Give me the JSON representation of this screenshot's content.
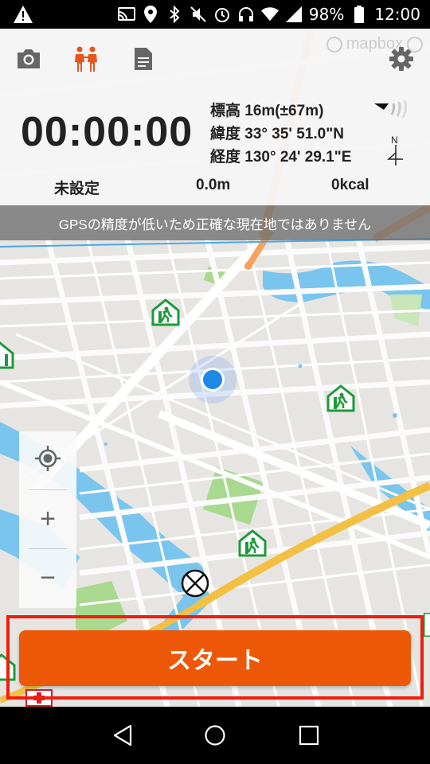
{
  "status_bar": {
    "battery": "98%",
    "time": "12:00",
    "icons": [
      "warning-icon",
      "cast-icon",
      "location-icon",
      "bluetooth-icon",
      "vibrate-icon",
      "alarm-icon",
      "headset-icon",
      "wifi-icon",
      "signal-icon",
      "battery-icon"
    ]
  },
  "toolbar": {
    "icons": [
      "camera-icon",
      "walkers-icon",
      "document-icon",
      "gear-icon"
    ],
    "active_color": "#e8541c"
  },
  "watermark": "mapbox",
  "timer": "00:00:00",
  "coords": {
    "altitude": "標高 16m(±67m)",
    "latitude": "緯度 33° 35' 51.0\"N",
    "longitude": "経度 130° 24' 29.1\"E",
    "compass_label": "N"
  },
  "stats": {
    "course": "未設定",
    "distance": "0.0m",
    "calories": "0kcal"
  },
  "gps_banner": "GPSの精度が低いため正確な現在地ではありません",
  "map": {
    "icons": [
      "evacuation-shelter-icon",
      "current-location-dot",
      "police-box-icon",
      "hospital-icon"
    ]
  },
  "zoom": {
    "locate_icon": "crosshair-icon",
    "zoom_in": "+",
    "zoom_out": "−"
  },
  "start_button": {
    "label": "スタート",
    "color": "#ec5807",
    "highlight_color": "#f21d0c"
  },
  "navbar": {
    "icons": [
      "back-icon",
      "home-icon",
      "recents-icon"
    ]
  }
}
